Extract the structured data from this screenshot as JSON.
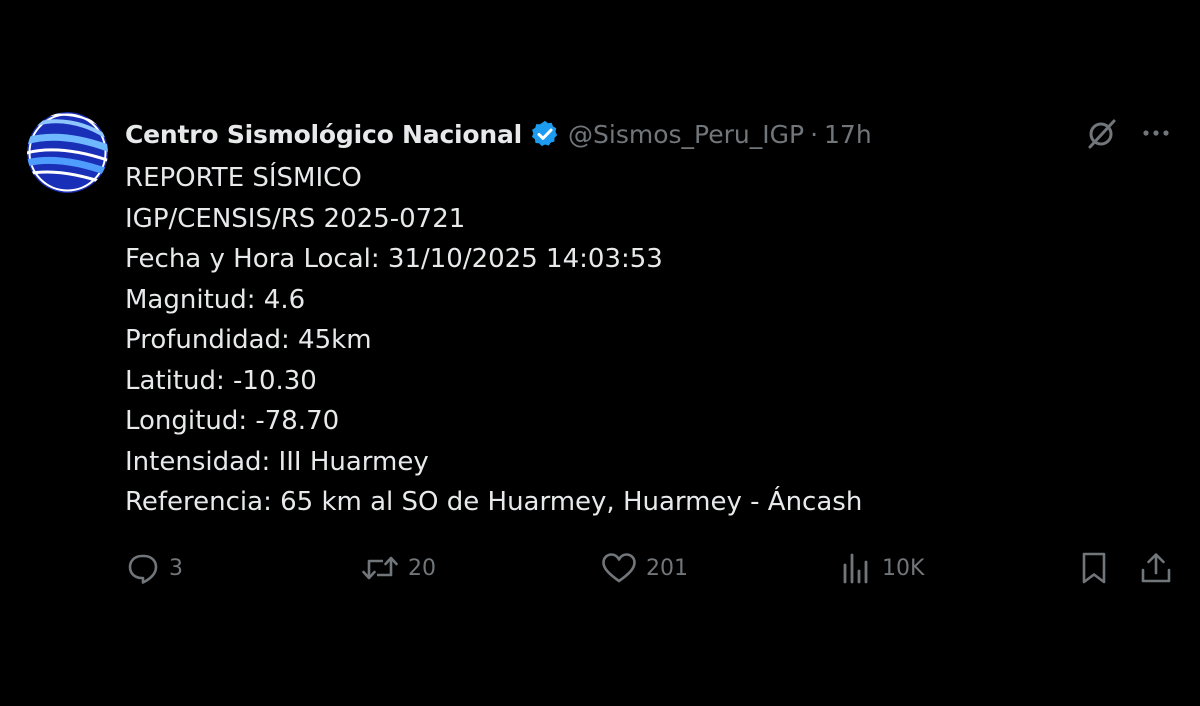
{
  "account": {
    "display_name": "Centro Sismológico Nacional",
    "handle": "@Sismos_Peru_IGP",
    "separator": "·",
    "time": "17h",
    "verified": true
  },
  "tweet": {
    "lines": [
      "REPORTE SÍSMICO",
      "IGP/CENSIS/RS 2025-0721",
      "Fecha y Hora Local: 31/10/2025 14:03:53",
      "Magnitud: 4.6",
      "Profundidad: 45km",
      "Latitud: -10.30",
      "Longitud: -78.70",
      "Intensidad: III Huarmey",
      "Referencia: 65 km al SO de Huarmey, Huarmey - Áncash"
    ]
  },
  "actions": {
    "replies": "3",
    "reposts": "20",
    "likes": "201",
    "views": "10K"
  },
  "icons": {
    "avatar": "wave-logo-icon",
    "verified": "verified-badge-icon",
    "grok": "grok-icon",
    "more": "more-options-icon",
    "reply": "reply-icon",
    "repost": "repost-icon",
    "like": "heart-icon",
    "views": "views-icon",
    "bookmark": "bookmark-icon",
    "share": "share-icon"
  },
  "colors": {
    "background": "#000000",
    "text": "#e7e9ea",
    "muted": "#71767b",
    "verified": "#1d9bf0",
    "avatar_dark": "#1a2fb8",
    "avatar_light": "#5ea8ff"
  }
}
